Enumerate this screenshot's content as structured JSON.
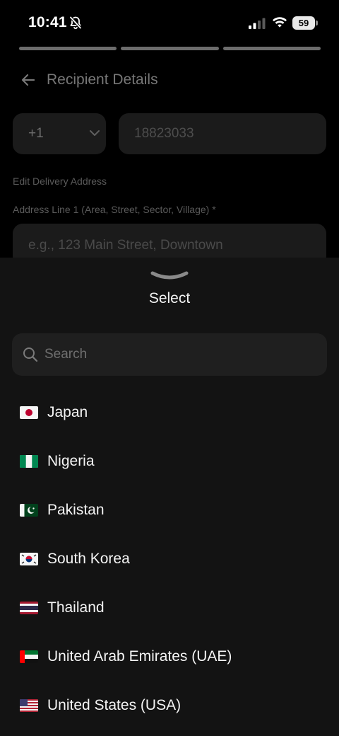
{
  "status_bar": {
    "time": "10:41",
    "battery": "59"
  },
  "header": {
    "title": "Recipient Details"
  },
  "form": {
    "country_code": "+1",
    "phone_number": "18823033",
    "delivery_section": "Edit Delivery Address",
    "address_line1_label": "Address Line 1 (Area, Street, Sector, Village) *",
    "address_line1_placeholder": "e.g., 123 Main Street, Downtown"
  },
  "sheet": {
    "title": "Select",
    "search_placeholder": "Search",
    "countries": [
      {
        "name": "Japan",
        "flag": "flag-japan-icon"
      },
      {
        "name": "Nigeria",
        "flag": "flag-nigeria-icon"
      },
      {
        "name": "Pakistan",
        "flag": "flag-pakistan-icon"
      },
      {
        "name": "South Korea",
        "flag": "flag-south-korea-icon"
      },
      {
        "name": "Thailand",
        "flag": "flag-thailand-icon"
      },
      {
        "name": "United Arab Emirates (UAE)",
        "flag": "flag-uae-icon"
      },
      {
        "name": "United States (USA)",
        "flag": "flag-usa-icon"
      }
    ]
  }
}
